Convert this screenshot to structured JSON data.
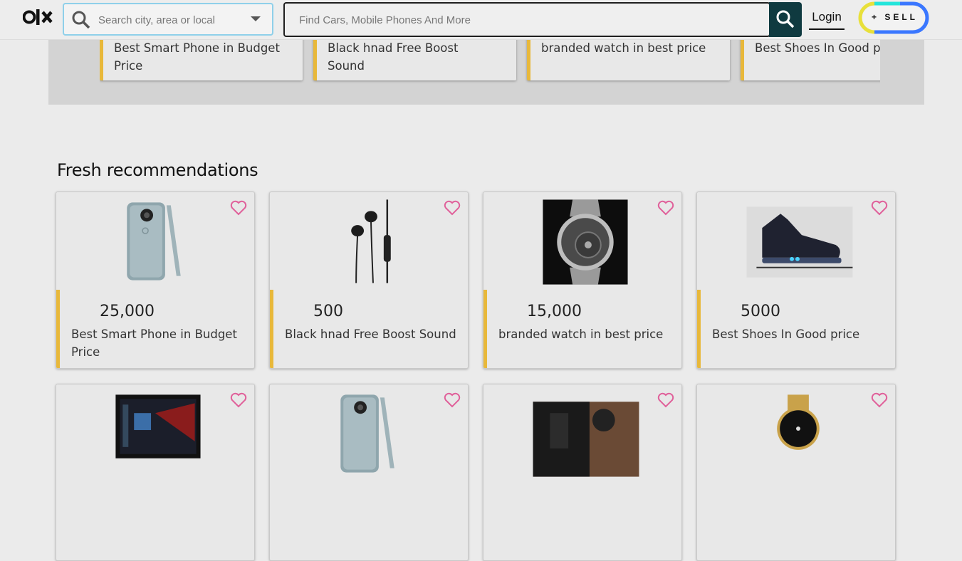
{
  "header": {
    "logo": "OLX",
    "location_placeholder": "Search city, area or local",
    "search_placeholder": "Find Cars, Mobile Phones And More",
    "login_label": "Login",
    "sell_label": "+ SELL"
  },
  "strip": {
    "items": [
      {
        "title": "Best Smart Phone in Budget Price"
      },
      {
        "title": "Black hnad Free Boost Sound"
      },
      {
        "title": "branded watch in best price"
      },
      {
        "title": "Best Shoes In Good price"
      }
    ]
  },
  "section_title": "Fresh recommendations",
  "cards": [
    {
      "price": "25,000",
      "title": "Best Smart Phone in Budget Price",
      "image": "phone"
    },
    {
      "price": "500",
      "title": "Black hnad Free Boost Sound",
      "image": "earphones"
    },
    {
      "price": "15,000",
      "title": "branded watch in best price",
      "image": "watch"
    },
    {
      "price": "5000",
      "title": "Best Shoes In Good price",
      "image": "shoe"
    },
    {
      "price": "",
      "title": "",
      "image": "laptop"
    },
    {
      "price": "",
      "title": "",
      "image": "phone"
    },
    {
      "price": "",
      "title": "",
      "image": "camera"
    },
    {
      "price": "",
      "title": "",
      "image": "gold-watch"
    }
  ],
  "colors": {
    "accent": "#e8b83a",
    "heart": "#e0609a",
    "search_button": "#0f3a40"
  }
}
